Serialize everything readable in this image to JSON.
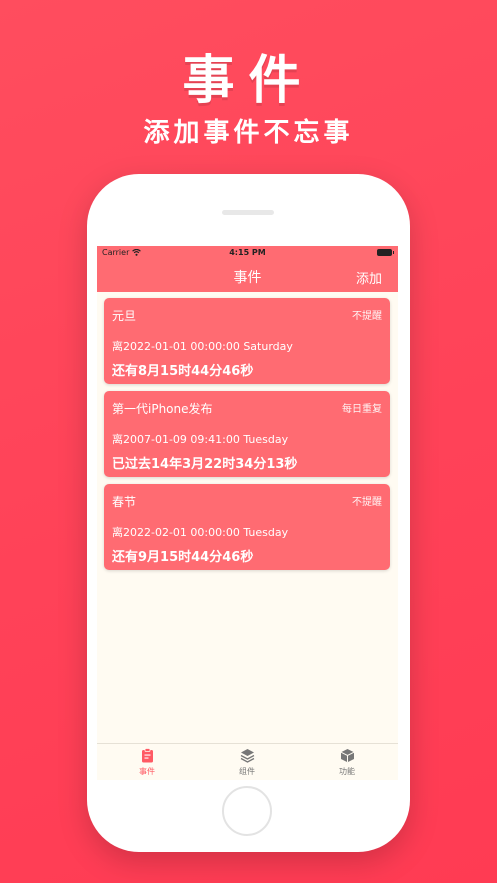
{
  "promo": {
    "title": "事件",
    "subtitle": "添加事件不忘事"
  },
  "status_bar": {
    "carrier": "Carrier",
    "time": "4:15 PM"
  },
  "nav": {
    "title": "事件",
    "add_label": "添加"
  },
  "events": [
    {
      "name": "元旦",
      "reminder": "不提醒",
      "date_line": "离2022-01-01 00:00:00  Saturday",
      "countdown": "还有8月15时44分46秒"
    },
    {
      "name": "第一代iPhone发布",
      "reminder": "每日重复",
      "date_line": "离2007-01-09 09:41:00  Tuesday",
      "countdown": "已过去14年3月22时34分13秒"
    },
    {
      "name": "春节",
      "reminder": "不提醒",
      "date_line": "离2022-02-01 00:00:00  Tuesday",
      "countdown": "还有9月15时44分46秒"
    }
  ],
  "tabs": [
    {
      "label": "事件",
      "icon": "clipboard-icon",
      "active": true
    },
    {
      "label": "组件",
      "icon": "layers-icon",
      "active": false
    },
    {
      "label": "功能",
      "icon": "box-icon",
      "active": false
    }
  ],
  "colors": {
    "background": "#ff4258",
    "card": "#ff6b72",
    "screen": "#fffbf2",
    "accent": "#ff5a64"
  }
}
